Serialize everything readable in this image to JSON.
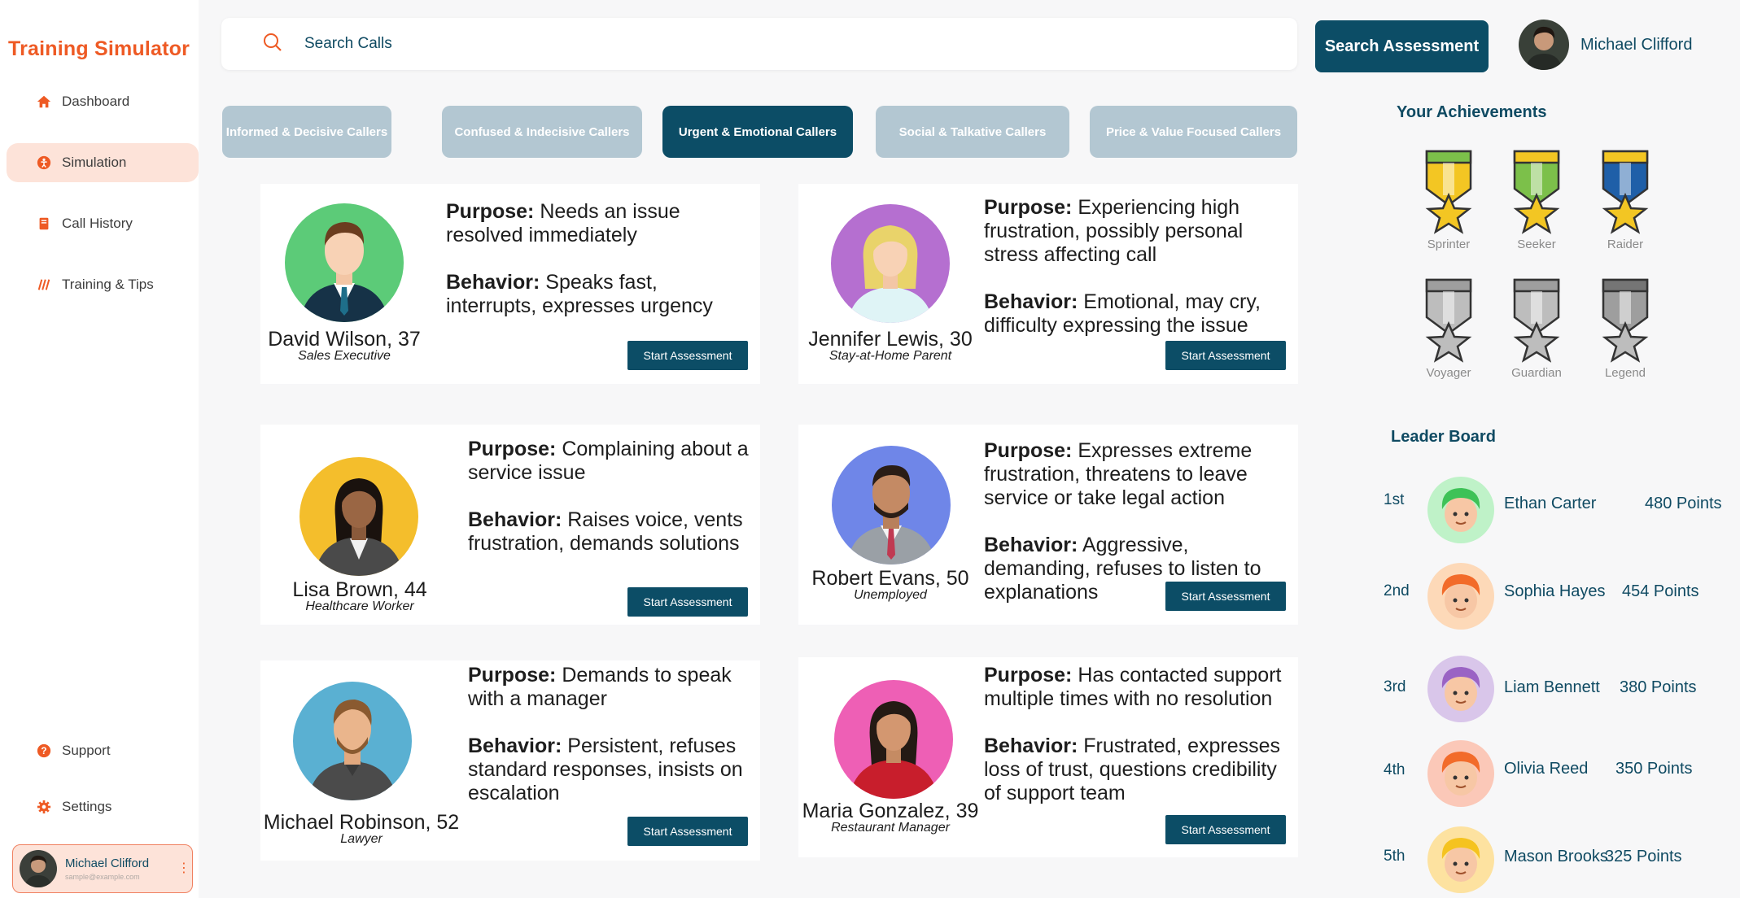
{
  "app": {
    "title": "Training Simulator"
  },
  "sidebar": {
    "items": [
      {
        "label": "Dashboard",
        "icon": "home-icon"
      },
      {
        "label": "Simulation",
        "icon": "simulation-icon"
      },
      {
        "label": "Call History",
        "icon": "book-icon"
      },
      {
        "label": "Training & Tips",
        "icon": "training-icon"
      }
    ],
    "bottom_items": [
      {
        "label": "Support",
        "icon": "help-icon"
      },
      {
        "label": "Settings",
        "icon": "gear-icon"
      }
    ],
    "user": {
      "name": "Michael Clifford",
      "email": "sample@example.com"
    }
  },
  "header": {
    "search_placeholder": "Search Calls",
    "search_button": "Search Assessment",
    "user_name": "Michael Clifford"
  },
  "tabs": [
    {
      "label": "Informed & Decisive Callers",
      "active": false
    },
    {
      "label": "Confused & Indecisive Callers",
      "active": false
    },
    {
      "label": "Urgent & Emotional Callers",
      "active": true
    },
    {
      "label": "Social & Talkative Callers",
      "active": false
    },
    {
      "label": "Price & Value Focused Callers",
      "active": false
    }
  ],
  "callers": [
    {
      "name": "David Wilson, 37",
      "role": "Sales Executive",
      "purpose_label": "Purpose:",
      "purpose": "Needs an issue resolved immediately",
      "behavior_label": "Behavior:",
      "behavior": "Speaks fast, interrupts, expresses urgency",
      "button": "Start Assessment",
      "bg": "#5ccb78"
    },
    {
      "name": "Jennifer Lewis, 30",
      "role": "Stay-at-Home Parent",
      "purpose_label": "Purpose:",
      "purpose": "Experiencing high frustration, possibly personal stress affecting call",
      "behavior_label": "Behavior:",
      "behavior": "Emotional, may cry, difficulty expressing the issue",
      "button": "Start Assessment",
      "bg": "#b56fd0"
    },
    {
      "name": "Lisa Brown, 44",
      "role": "Healthcare Worker",
      "purpose_label": "Purpose:",
      "purpose": "Complaining about a service issue",
      "behavior_label": "Behavior:",
      "behavior": "Raises voice, vents frustration, demands solutions",
      "button": "Start Assessment",
      "bg": "#f4be2c"
    },
    {
      "name": "Robert Evans, 50",
      "role": "Unemployed",
      "purpose_label": "Purpose:",
      "purpose": "Expresses extreme frustration, threatens to leave service or take legal action",
      "behavior_label": "Behavior:",
      "behavior": "Aggressive, demanding, refuses to listen to explanations",
      "button": "Start Assessment",
      "bg": "#6f86e8"
    },
    {
      "name": "Michael Robinson, 52",
      "role": "Lawyer",
      "purpose_label": "Purpose:",
      "purpose": "Demands to speak with a manager",
      "behavior_label": "Behavior:",
      "behavior": "Persistent, refuses standard responses, insists on escalation",
      "button": "Start Assessment",
      "bg": "#5ab0d2"
    },
    {
      "name": "Maria Gonzalez, 39",
      "role": "Restaurant Manager",
      "purpose_label": "Purpose:",
      "purpose": "Has contacted support multiple times with no resolution",
      "behavior_label": "Behavior:",
      "behavior": "Frustrated, expresses loss of trust, questions credibility of support team",
      "button": "Start Assessment",
      "bg": "#ee5fb5"
    }
  ],
  "achievements": {
    "title": "Your Achievements",
    "items": [
      {
        "label": "Sprinter",
        "ribbon": "#f3c623",
        "accent": "#7cc04a"
      },
      {
        "label": "Seeker",
        "ribbon": "#7cc04a",
        "accent": "#f3c623"
      },
      {
        "label": "Raider",
        "ribbon": "#1f5fa8",
        "accent": "#f3c623"
      },
      {
        "label": "Voyager",
        "ribbon": "#bdbdbd",
        "accent": "#9e9e9e"
      },
      {
        "label": "Guardian",
        "ribbon": "#bdbdbd",
        "accent": "#9e9e9e"
      },
      {
        "label": "Legend",
        "ribbon": "#9e9e9e",
        "accent": "#757575"
      }
    ]
  },
  "leaderboard": {
    "title": "Leader Board",
    "rows": [
      {
        "rank": "1st",
        "name": "Ethan Carter",
        "points": "480 Points",
        "bg": "#bff2c8",
        "hair": "#3ec257"
      },
      {
        "rank": "2nd",
        "name": "Sophia Hayes",
        "points": "454 Points",
        "bg": "#fdd9b8",
        "hair": "#f26b2a"
      },
      {
        "rank": "3rd",
        "name": "Liam Bennett",
        "points": "380 Points",
        "bg": "#d9c6ea",
        "hair": "#9a63c4"
      },
      {
        "rank": "4th",
        "name": "Olivia Reed",
        "points": "350 Points",
        "bg": "#fbc8b8",
        "hair": "#f26b2a"
      },
      {
        "rank": "5th",
        "name": "Mason Brooks",
        "points": "325 Points",
        "bg": "#fde2a0",
        "hair": "#f5c31f"
      }
    ]
  }
}
